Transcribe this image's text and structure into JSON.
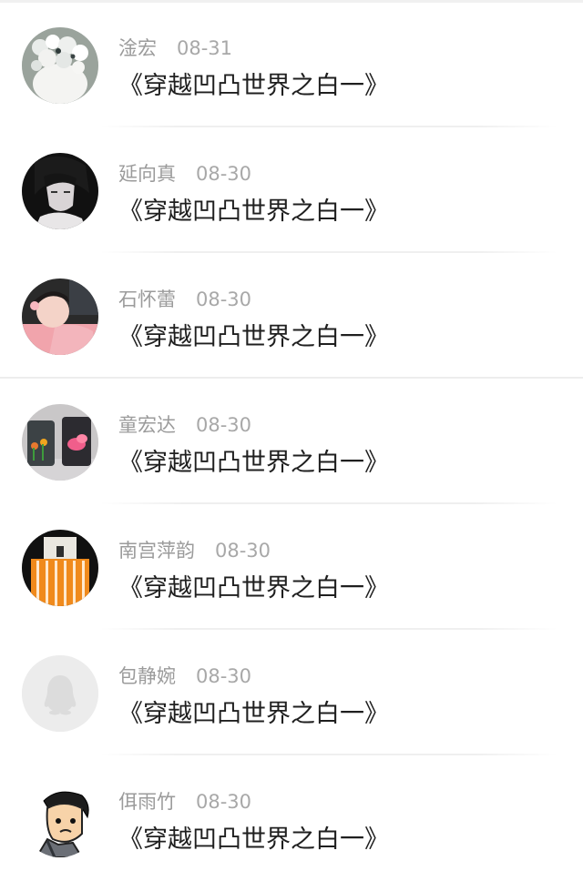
{
  "comments": [
    {
      "name": "淦宏",
      "date": "08-31",
      "text": "《穿越凹凸世界之白一》",
      "avatar": "white-flowers-vase-avatar"
    },
    {
      "name": "延向真",
      "date": "08-30",
      "text": "《穿越凹凸世界之白一》",
      "avatar": "anime-boy-dark-avatar"
    },
    {
      "name": "石怀蕾",
      "date": "08-30",
      "text": "《穿越凹凸世界之白一》",
      "avatar": "girl-pink-avatar"
    },
    {
      "name": "童宏达",
      "date": "08-30",
      "text": "《穿越凹凸世界之白一》",
      "avatar": "painted-jars-avatar"
    },
    {
      "name": "南宫萍韵",
      "date": "08-30",
      "text": "《穿越凹凸世界之白一》",
      "avatar": "orange-bag-avatar"
    },
    {
      "name": "包静婉",
      "date": "08-30",
      "text": "《穿越凹凸世界之白一》",
      "avatar": "default-penguin-avatar"
    },
    {
      "name": "佴雨竹",
      "date": "08-30",
      "text": "《穿越凹凸世界之白一》",
      "avatar": "cartoon-man-avatar"
    }
  ],
  "colors": {
    "name_text": "#9b9b9b",
    "date_text": "#a8a8a8",
    "comment_text": "#1f1f1f",
    "divider": "#efefef"
  }
}
